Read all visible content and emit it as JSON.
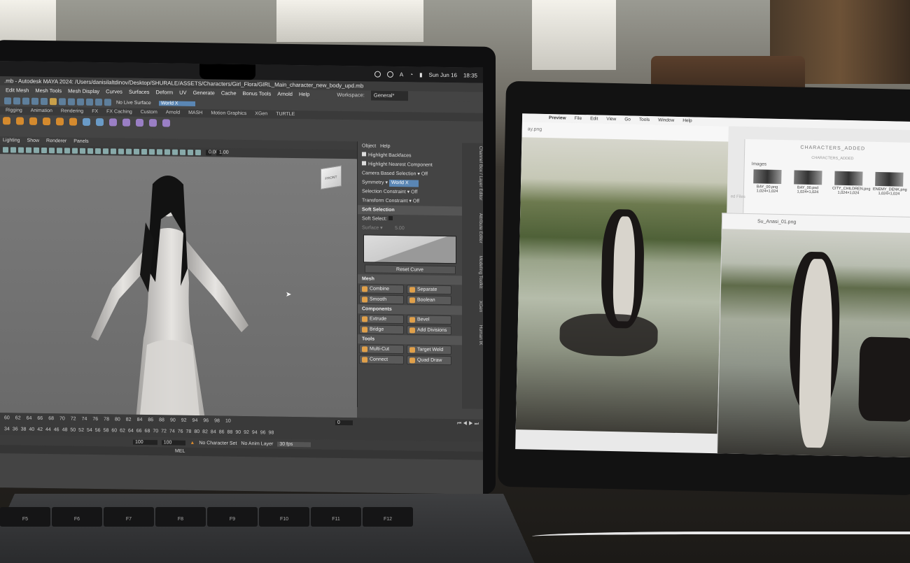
{
  "laptop": {
    "mac_menubar": {
      "date": "Sun Jun 16",
      "time": "18:35",
      "input": "A"
    },
    "maya": {
      "title": ".mb - Autodesk MAYA 2024: /Users/danisilaltdinov/Desktop/SHURALE/ASSETS/Characters/Girl_Flora/GIRL_Main_character_new_body_upd.mb",
      "menus": [
        "Edit Mesh",
        "Mesh Tools",
        "Mesh Display",
        "Curves",
        "Surfaces",
        "Deform",
        "UV",
        "Generate",
        "Cache",
        "Bonus Tools",
        "Arnold",
        "Help"
      ],
      "workspace_label": "Workspace:",
      "workspace_value": "General*",
      "status": {
        "live_surface": "No Live Surface",
        "symmetry": "World X"
      },
      "shelf_tabs": [
        "Rigging",
        "Animation",
        "Rendering",
        "FX",
        "FX Caching",
        "Custom",
        "Arnold",
        "MASH",
        "Motion Graphics",
        "XGen",
        "TURTLE"
      ],
      "viewport_menus": [
        "Lighting",
        "Show",
        "Renderer",
        "Panels"
      ],
      "viewport_values": [
        "0.00",
        "1.00"
      ],
      "viewcube_label": "FRONT",
      "tool_settings": {
        "menus": [
          "Object",
          "Help"
        ],
        "highlight_backfaces": "Highlight Backfaces",
        "highlight_nearest": "Highlight Nearest Component",
        "camera_based": "Camera Based Selection",
        "camera_based_value": "Off",
        "symmetry_label": "Symmetry",
        "symmetry_value": "World X",
        "selection_constraint": "Selection Constraint",
        "selection_constraint_value": "Off",
        "transform_constraint": "Transform Constraint",
        "transform_constraint_value": "Off",
        "soft_selection": "Soft Selection",
        "soft_select": "Soft Select:",
        "surface": "Surface",
        "falloff": "5.00",
        "reset_curve": "Reset Curve",
        "mesh_header": "Mesh",
        "mesh_buttons": [
          "Combine",
          "Separate",
          "Smooth",
          "Boolean"
        ],
        "components_header": "Components",
        "component_buttons": [
          "Extrude",
          "Bevel",
          "Bridge",
          "Add Divisions"
        ],
        "tools_header": "Tools",
        "tool_buttons": [
          "Multi-Cut",
          "Target Weld",
          "Connect",
          "Quad Draw"
        ]
      },
      "side_tabs": [
        "Channel Box / Layer Editor",
        "Attribute Editor",
        "Modeling Toolkit",
        "XGen",
        "Human IK"
      ],
      "timeline_top_ticks": [
        "60",
        "62",
        "64",
        "66",
        "68",
        "70",
        "72",
        "74",
        "76",
        "78",
        "80",
        "82",
        "84",
        "86",
        "88",
        "90",
        "92",
        "94",
        "96",
        "98",
        "10"
      ],
      "current_frame": "0",
      "timeline_bottom_ticks": [
        "34",
        "36",
        "38",
        "40",
        "42",
        "44",
        "46",
        "48",
        "50",
        "52",
        "54",
        "56",
        "58",
        "60",
        "62",
        "64",
        "66",
        "68",
        "70",
        "72",
        "74",
        "76",
        "78",
        "80",
        "82",
        "84",
        "86",
        "88",
        "90",
        "92",
        "94",
        "96",
        "98"
      ],
      "range_start": "100",
      "range_end": "100",
      "character_set": "No Character Set",
      "anim_layer": "No Anim Layer",
      "fps": "30 fps",
      "mel": "MEL"
    },
    "keys": [
      "F5",
      "F6",
      "F7",
      "F8",
      "F9",
      "F10",
      "F11",
      "F12"
    ]
  },
  "tablet": {
    "menubar": [
      "Preview",
      "File",
      "Edit",
      "View",
      "Go",
      "Tools",
      "Window",
      "Help"
    ],
    "preview1_title": "ay.png",
    "finder": {
      "title": "CHARACTERS_ADDED",
      "subtitle": "CHARACTERS_ADDED",
      "section": "Images",
      "sidebar_hint": "ed Files",
      "items": [
        {
          "name": "BAY_00.png",
          "size": "1,024×1,024"
        },
        {
          "name": "BAY_00.psd",
          "size": "1,024×1,024"
        },
        {
          "name": "CITY_CHILDREN.png",
          "size": "1,024×1,024"
        },
        {
          "name": "ENEMY_DENK.png",
          "size": "1,024×1,024"
        }
      ]
    },
    "preview2_title": "Su_Anasi_01.png"
  }
}
